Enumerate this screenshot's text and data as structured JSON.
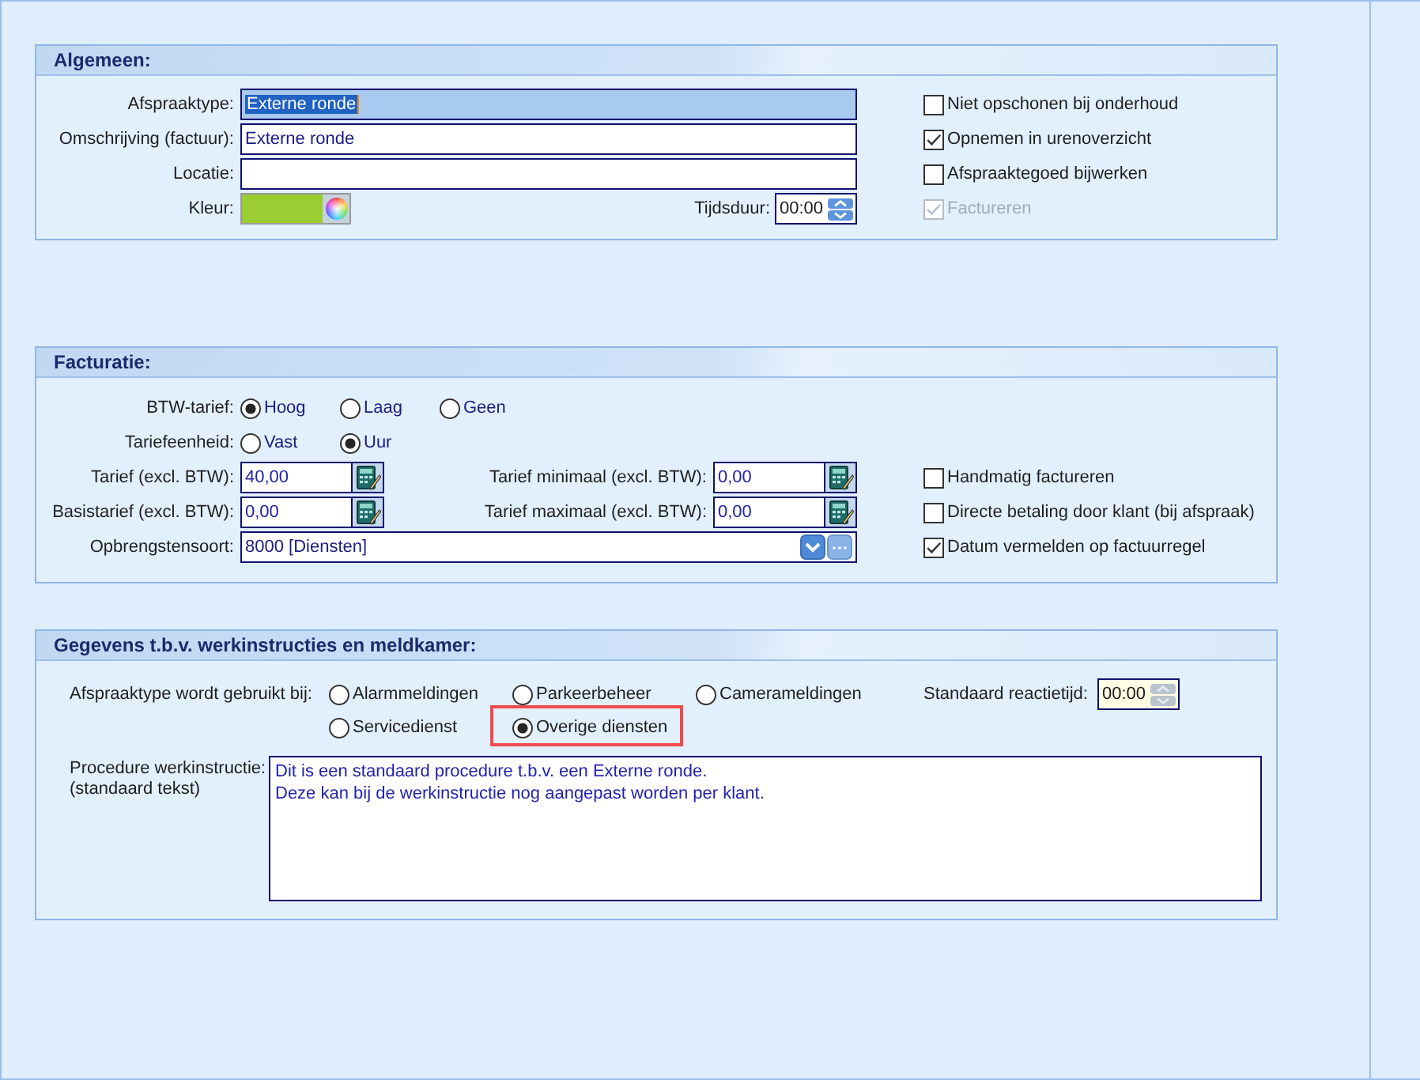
{
  "algemeen": {
    "title": "Algemeen:",
    "fields": [
      {
        "label": "Afspraaktype:",
        "value": "Externe ronde",
        "focused": true
      },
      {
        "label": "Omschrijving (factuur):",
        "value": "Externe ronde",
        "focused": false
      },
      {
        "label": "Locatie:",
        "focused": false
      }
    ],
    "kleur": {
      "label": "Kleur:",
      "color": "#9acd32"
    },
    "tijdsduur": {
      "label": "Tijdsduur:",
      "value": "00:00",
      "highlighted": false,
      "spinner_enabled": true
    },
    "checkboxes": [
      {
        "label": "Niet opschonen bij onderhoud",
        "checked": false,
        "disabled": false
      },
      {
        "label": "Opnemen in urenoverzicht",
        "checked": true,
        "disabled": false
      },
      {
        "label": "Afspraaktegoed bijwerken",
        "checked": false,
        "disabled": false
      },
      {
        "label": "Factureren",
        "checked": true,
        "disabled": true
      }
    ]
  },
  "facturatie": {
    "title": "Facturatie:",
    "radio_groups": [
      {
        "label": "BTW-tarief:",
        "options": [
          {
            "label": "Hoog",
            "selected": true
          },
          {
            "label": "Laag",
            "selected": false
          },
          {
            "label": "Geen",
            "selected": false
          }
        ]
      },
      {
        "label": "Tariefeenheid:",
        "options": [
          {
            "label": "Vast",
            "selected": false
          },
          {
            "label": "Uur",
            "selected": true
          }
        ]
      }
    ],
    "amount_rows": [
      {
        "left": {
          "label": "Tarief (excl. BTW):",
          "value": "40,00"
        },
        "right": {
          "label": "Tarief minimaal (excl. BTW):",
          "value": "0,00"
        }
      },
      {
        "left": {
          "label": "Basistarief (excl. BTW):",
          "value": "0,00"
        },
        "right": {
          "label": "Tarief maximaal (excl. BTW):",
          "value": "0,00"
        }
      }
    ],
    "opbrengstensoort": {
      "label": "Opbrengstensoort:",
      "value": "8000 [Diensten]"
    },
    "checkboxes": [
      {
        "label": "Handmatig factureren",
        "checked": false,
        "disabled": false
      },
      {
        "label": "Directe betaling door klant (bij afspraak)",
        "checked": false,
        "disabled": false
      },
      {
        "label": "Datum vermelden op factuurregel",
        "checked": true,
        "disabled": false
      }
    ]
  },
  "meldkamer": {
    "title": "Gegevens t.b.v. werkinstructies en meldkamer:",
    "usage": {
      "label": "Afspraaktype wordt gebruikt bij:",
      "options": [
        {
          "label": "Alarmmeldingen",
          "selected": false,
          "highlighted": false
        },
        {
          "label": "Parkeerbeheer",
          "selected": false,
          "highlighted": false
        },
        {
          "label": "Camerameldingen",
          "selected": false,
          "highlighted": false
        },
        {
          "label": "Servicedienst",
          "selected": false,
          "highlighted": false
        },
        {
          "label": "Overige diensten",
          "selected": true,
          "highlighted": true
        }
      ]
    },
    "reactietijd": {
      "label": "Standaard reactietijd:",
      "value": "00:00",
      "highlighted": true,
      "spinner_enabled": false
    },
    "procedure": {
      "label": "Procedure werkinstructie:",
      "sublabel": "(standaard tekst)",
      "text": "Dit is een standaard procedure t.b.v. een Externe ronde.\nDeze kan bij de werkinstructie nog aangepast worden per klant."
    }
  }
}
